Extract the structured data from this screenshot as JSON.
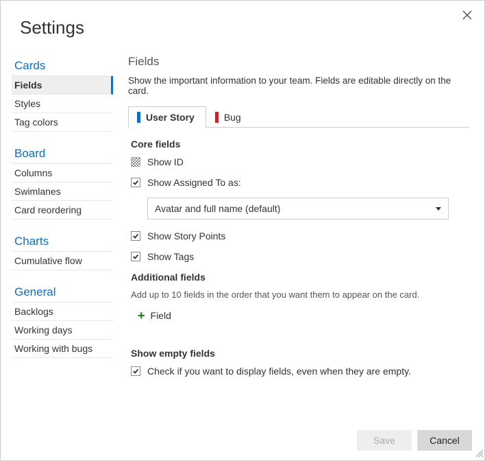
{
  "dialog": {
    "title": "Settings"
  },
  "sidebar": {
    "sections": [
      {
        "title": "Cards",
        "items": [
          {
            "label": "Fields",
            "selected": true
          },
          {
            "label": "Styles"
          },
          {
            "label": "Tag colors"
          }
        ]
      },
      {
        "title": "Board",
        "items": [
          {
            "label": "Columns"
          },
          {
            "label": "Swimlanes"
          },
          {
            "label": "Card reordering"
          }
        ]
      },
      {
        "title": "Charts",
        "items": [
          {
            "label": "Cumulative flow"
          }
        ]
      },
      {
        "title": "General",
        "items": [
          {
            "label": "Backlogs"
          },
          {
            "label": "Working days"
          },
          {
            "label": "Working with bugs"
          }
        ]
      }
    ]
  },
  "content": {
    "title": "Fields",
    "description": "Show the important information to your team. Fields are editable directly on the card.",
    "tabs": [
      {
        "label": "User Story",
        "color": "#106ebe",
        "active": true
      },
      {
        "label": "Bug",
        "color": "#c5252b"
      }
    ],
    "coreFields": {
      "heading": "Core fields",
      "items": [
        {
          "label": "Show ID",
          "checked": false,
          "dither": true
        },
        {
          "label": "Show Assigned To as:",
          "checked": true,
          "hasDropdown": true,
          "dropdownValue": "Avatar and full name (default)"
        },
        {
          "label": "Show Story Points",
          "checked": true
        },
        {
          "label": "Show Tags",
          "checked": true
        }
      ]
    },
    "additional": {
      "heading": "Additional fields",
      "description": "Add up to 10 fields in the order that you want them to appear on the card.",
      "addButton": "Field"
    },
    "empty": {
      "heading": "Show empty fields",
      "items": [
        {
          "label": "Check if you want to display fields, even when they are empty.",
          "checked": true
        }
      ]
    }
  },
  "footer": {
    "save": "Save",
    "cancel": "Cancel"
  }
}
